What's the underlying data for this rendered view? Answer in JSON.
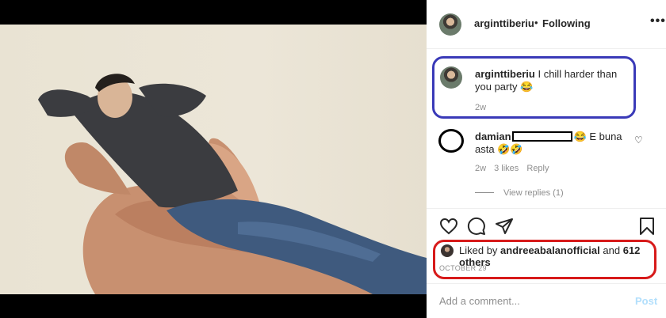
{
  "post": {
    "username": "arginttiberiu",
    "separator": "•",
    "follow_status": "Following",
    "more_icon": "more-horizontal-icon"
  },
  "caption": {
    "username": "arginttiberiu",
    "text": "I chill harder than you party",
    "emoji": "😂",
    "time": "2w"
  },
  "comment": {
    "username": "damian",
    "text_after": "E buna asta",
    "emoji_before": "😂",
    "emojis_after": "🤣🤣",
    "time": "2w",
    "likes": "3 likes",
    "reply_label": "Reply",
    "view_replies": "View replies (1)"
  },
  "actions": {
    "like_icon": "heart-icon",
    "comment_icon": "comment-icon",
    "share_icon": "share-icon",
    "save_icon": "bookmark-icon"
  },
  "likes": {
    "prefix": "Liked by",
    "user": "andreeabalanofficial",
    "and": "and",
    "others": "612 others"
  },
  "date": "OCTOBER 29",
  "add_comment": {
    "placeholder": "Add a comment...",
    "post_label": "Post"
  },
  "colors": {
    "caption_highlight": "#3a3ab8",
    "likes_highlight": "#d71a1a",
    "post_button": "#b2dffc"
  }
}
